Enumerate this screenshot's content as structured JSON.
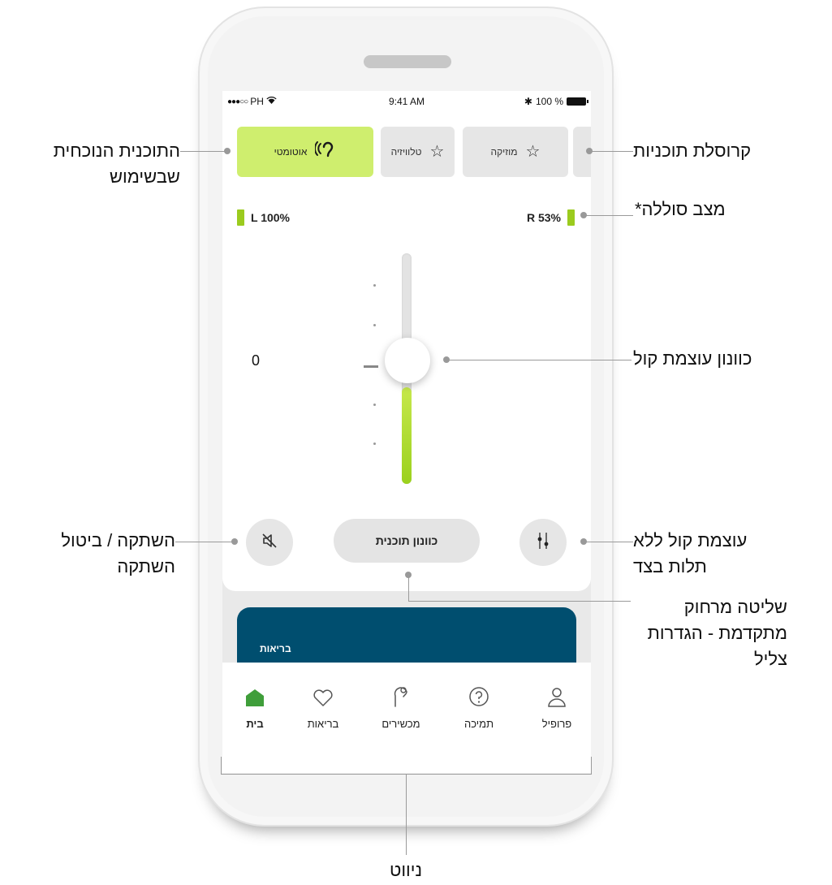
{
  "status_bar": {
    "carrier": "PH",
    "time": "9:41 AM",
    "battery_text": "100 %"
  },
  "programs": [
    {
      "label": "אוטומטי",
      "icon": "hearing-aid-icon",
      "active": true
    },
    {
      "label": "טלוויזיה",
      "icon": "star-icon",
      "active": false
    },
    {
      "label": "מוזיקה",
      "icon": "star-icon",
      "active": false
    }
  ],
  "battery": {
    "left": "L 100%",
    "right": "R 53%"
  },
  "volume": {
    "value": "0",
    "level": 0.42
  },
  "actions": {
    "program_tuning": "כוונון תוכנית"
  },
  "health_card": {
    "title": "בריאות"
  },
  "nav": [
    {
      "label": "בית",
      "icon": "home-icon",
      "active": true
    },
    {
      "label": "בריאות",
      "icon": "heart-icon",
      "active": false
    },
    {
      "label": "מכשירים",
      "icon": "hearing-device-icon",
      "active": false
    },
    {
      "label": "תמיכה",
      "icon": "help-icon",
      "active": false
    },
    {
      "label": "פרופיל",
      "icon": "profile-icon",
      "active": false
    }
  ],
  "annotations": {
    "current_program_1": "התוכנית הנוכחית",
    "current_program_2": "שבשימוש",
    "carousel": "קרוסלת תוכניות",
    "battery_status": "מצב סוללה*",
    "volume_control": "כוונון עוצמת קול",
    "mute_1": "השתקה / ביטול",
    "mute_2": "השתקה",
    "independent_1": "עוצמת קול ללא",
    "independent_2": "תלות בצד",
    "remote_1": "שליטה מרחוק",
    "remote_2": "מתקדמת - הגדרות",
    "remote_3": "צליל",
    "navigation": "ניווט"
  }
}
